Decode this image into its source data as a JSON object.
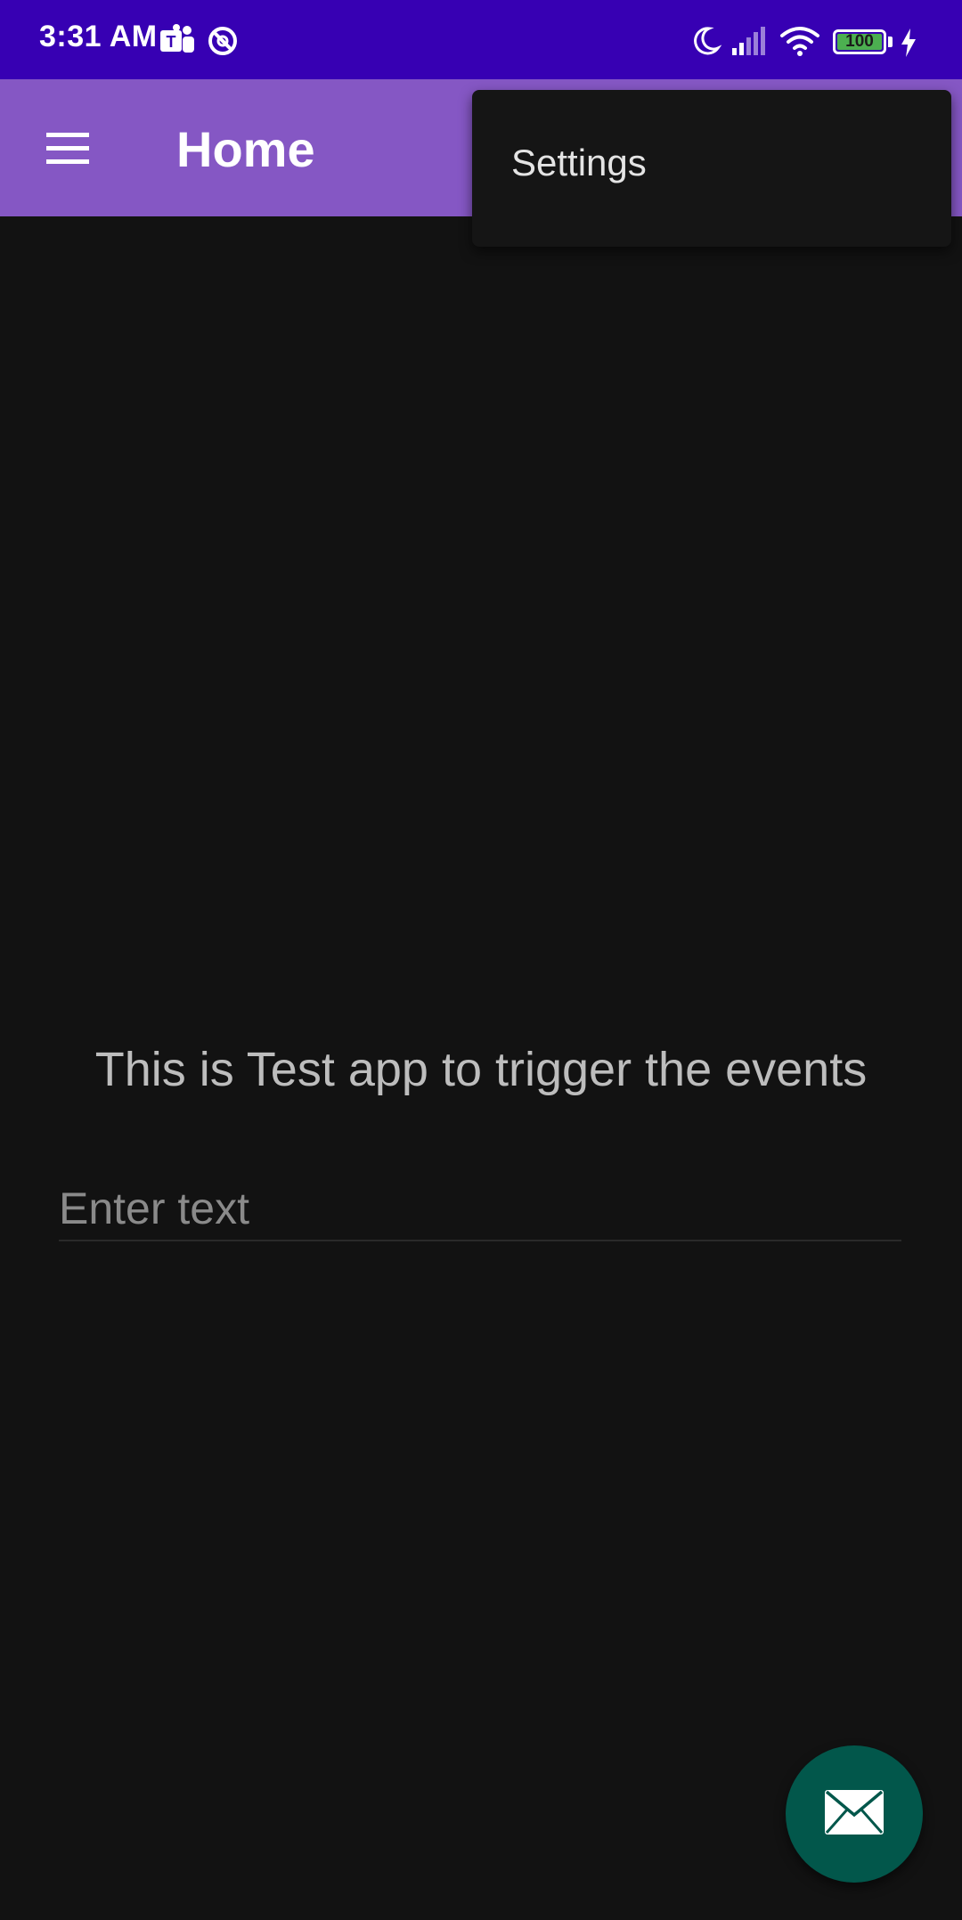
{
  "status_bar": {
    "time": "3:31 AM",
    "battery_level": "100",
    "battery_percent": 100,
    "icons": [
      "teams-icon",
      "do-not-disturb-icon",
      "moon-icon",
      "signal-icon",
      "wifi-icon",
      "battery-icon",
      "charging-icon"
    ]
  },
  "app_bar": {
    "title": "Home",
    "menu_icon": "hamburger-menu-icon",
    "color": "#8557C4"
  },
  "overflow_menu": {
    "items": [
      {
        "label": "Settings"
      }
    ]
  },
  "main": {
    "headline": "This is Test app to trigger the events",
    "input": {
      "placeholder": "Enter text",
      "value": ""
    }
  },
  "fab": {
    "icon": "email-icon",
    "color": "#02574B"
  },
  "colors": {
    "status_bar": "#3700B3",
    "background": "#121212",
    "menu_background": "#151515"
  }
}
